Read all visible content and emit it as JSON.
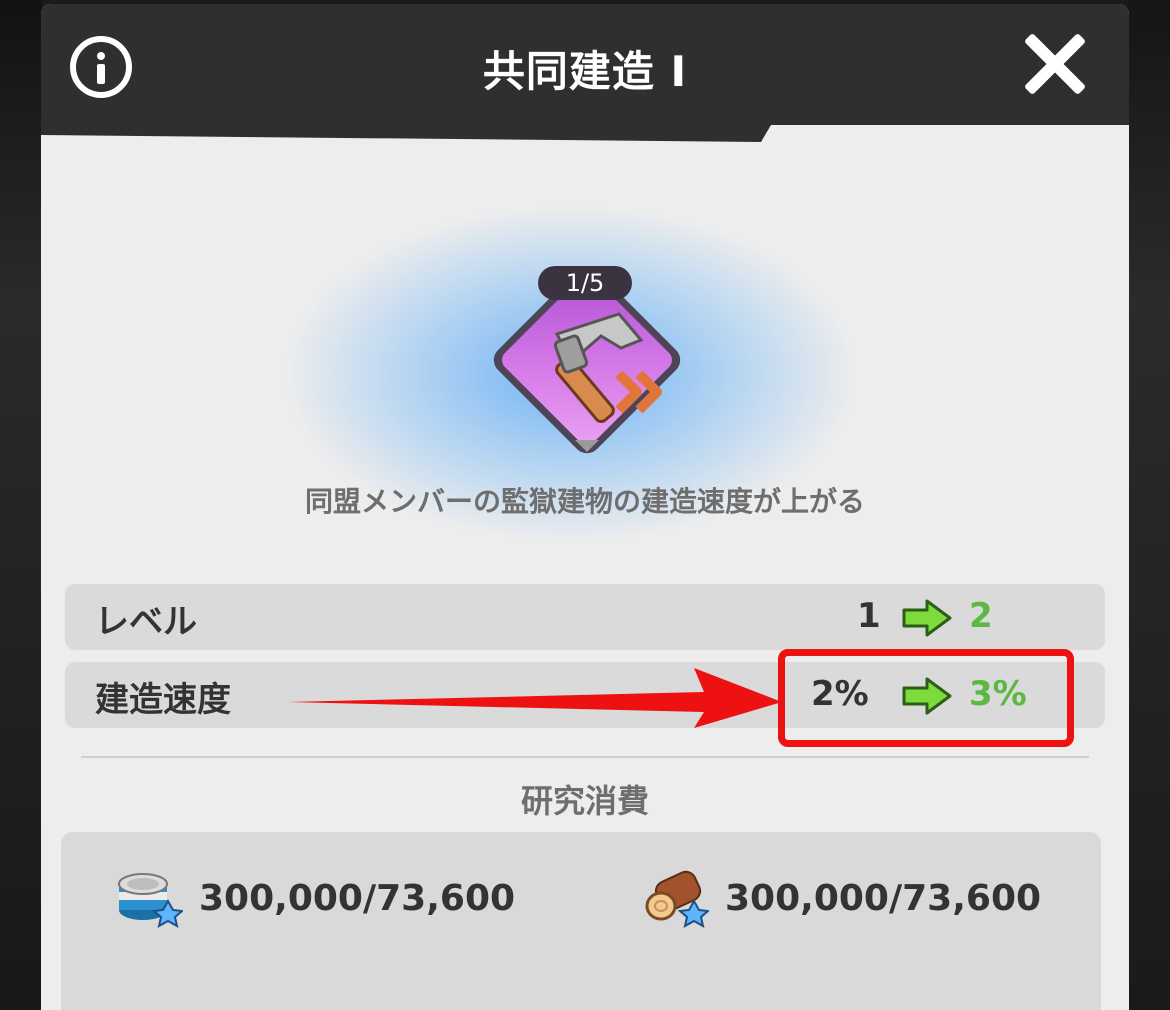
{
  "header": {
    "title": "共同建造 I"
  },
  "skill": {
    "level_badge": "1/5",
    "icon": "hammer-icon",
    "description": "同盟メンバーの監獄建物の建造速度が上がる"
  },
  "stats": [
    {
      "label": "レベル",
      "current": "1",
      "next": "2"
    },
    {
      "label": "建造速度",
      "current": "2%",
      "next": "3%"
    }
  ],
  "research_cost": {
    "title": "研究消費",
    "items": [
      {
        "icon": "food-can-icon",
        "value": "300,000/73,600"
      },
      {
        "icon": "wood-log-icon",
        "value": "300,000/73,600"
      }
    ]
  },
  "colors": {
    "header_bg": "#2f2f2f",
    "panel_bg": "#ededed",
    "increase_green": "#5ab843",
    "highlight_red": "#ee1111",
    "skill_purple": "#b455d6"
  }
}
